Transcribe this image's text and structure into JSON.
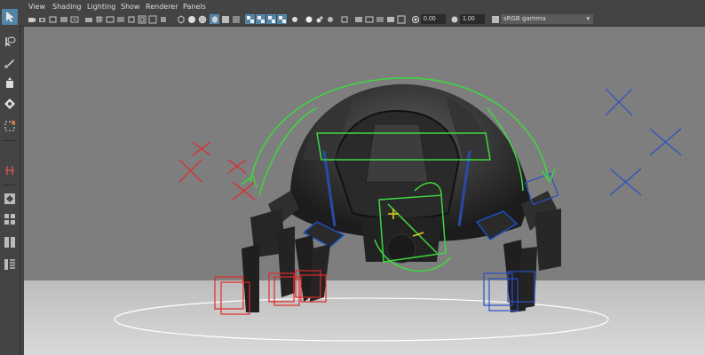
{
  "menubar": {
    "items": [
      "View",
      "Shading",
      "Lighting",
      "Show",
      "Renderer",
      "Panels"
    ]
  },
  "toolbar": {
    "exposure_value": "0.00",
    "gamma_value": "1.00",
    "color_space": "sRGB gamma",
    "accent_color": "#5285a6"
  },
  "left_toolbar": {
    "tools": [
      "select-arrow-icon",
      "lasso-icon",
      "paint-select-icon",
      "move-icon",
      "rotate-icon",
      "scale-icon",
      "snap-grid-icon",
      "joint-icon",
      "single-layout-icon",
      "four-layout-icon",
      "two-layout-icon",
      "outliner-layout-icon"
    ]
  },
  "viewport": {
    "background": "#7e7e7e",
    "floor_color": "#cfcfcf"
  }
}
